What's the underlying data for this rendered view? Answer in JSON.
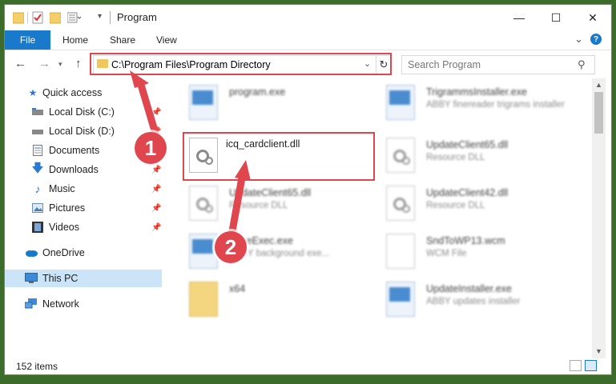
{
  "window": {
    "title": "Program",
    "controls": {
      "minimize": "—",
      "maximize": "☐",
      "close": "✕"
    }
  },
  "ribbon": {
    "tabs": [
      {
        "label": "File"
      },
      {
        "label": "Home"
      },
      {
        "label": "Share"
      },
      {
        "label": "View"
      }
    ],
    "help": "?"
  },
  "navbar": {
    "address": "C:\\Program Files\\Program Directory",
    "search_placeholder": "Search Program"
  },
  "sidebar": {
    "items": [
      {
        "label": "Quick access",
        "icon": "star-icon"
      },
      {
        "label": "Local Disk (C:)",
        "icon": "drive-icon",
        "pinned": true
      },
      {
        "label": "Local Disk (D:)",
        "icon": "drive-icon",
        "pinned": true
      },
      {
        "label": "Documents",
        "icon": "documents-icon",
        "pinned": true
      },
      {
        "label": "Downloads",
        "icon": "download-icon",
        "pinned": true
      },
      {
        "label": "Music",
        "icon": "music-icon",
        "pinned": true
      },
      {
        "label": "Pictures",
        "icon": "pictures-icon",
        "pinned": true
      },
      {
        "label": "Videos",
        "icon": "videos-icon",
        "pinned": true
      },
      {
        "label": "OneDrive",
        "icon": "cloud-icon"
      },
      {
        "label": "This PC",
        "icon": "computer-icon",
        "selected": true
      },
      {
        "label": "Network",
        "icon": "network-icon"
      }
    ]
  },
  "files": [
    {
      "name": "program.exe",
      "desc": "",
      "type": "exe"
    },
    {
      "name": "TrigrammsInstaller.exe",
      "desc": "ABBY finereader trigrams installer",
      "type": "exe"
    },
    {
      "name": "icq_cardclient.dll",
      "desc": "",
      "type": "dll"
    },
    {
      "name": "UpdateClient65.dll",
      "desc": "Resource DLL",
      "type": "dll"
    },
    {
      "name": "UpdateClient65.dll",
      "desc": "Resource DLL",
      "type": "dll"
    },
    {
      "name": "UpdateClient42.dll",
      "desc": "Resource DLL",
      "type": "dll"
    },
    {
      "name": "ScheExec.exe",
      "desc": "ABBY background exe...",
      "type": "exe"
    },
    {
      "name": "SndToWP13.wcm",
      "desc": "WCM File",
      "type": "doc"
    },
    {
      "name": "x64",
      "desc": "",
      "type": "folder"
    },
    {
      "name": "UpdateInstaller.exe",
      "desc": "ABBY updates installer",
      "type": "exe"
    }
  ],
  "status": {
    "items_count": "152 items"
  },
  "callouts": {
    "one": "1",
    "two": "2"
  },
  "colors": {
    "accent": "#1979ca",
    "highlight": "#e0464e",
    "selection": "#cce4f7"
  }
}
